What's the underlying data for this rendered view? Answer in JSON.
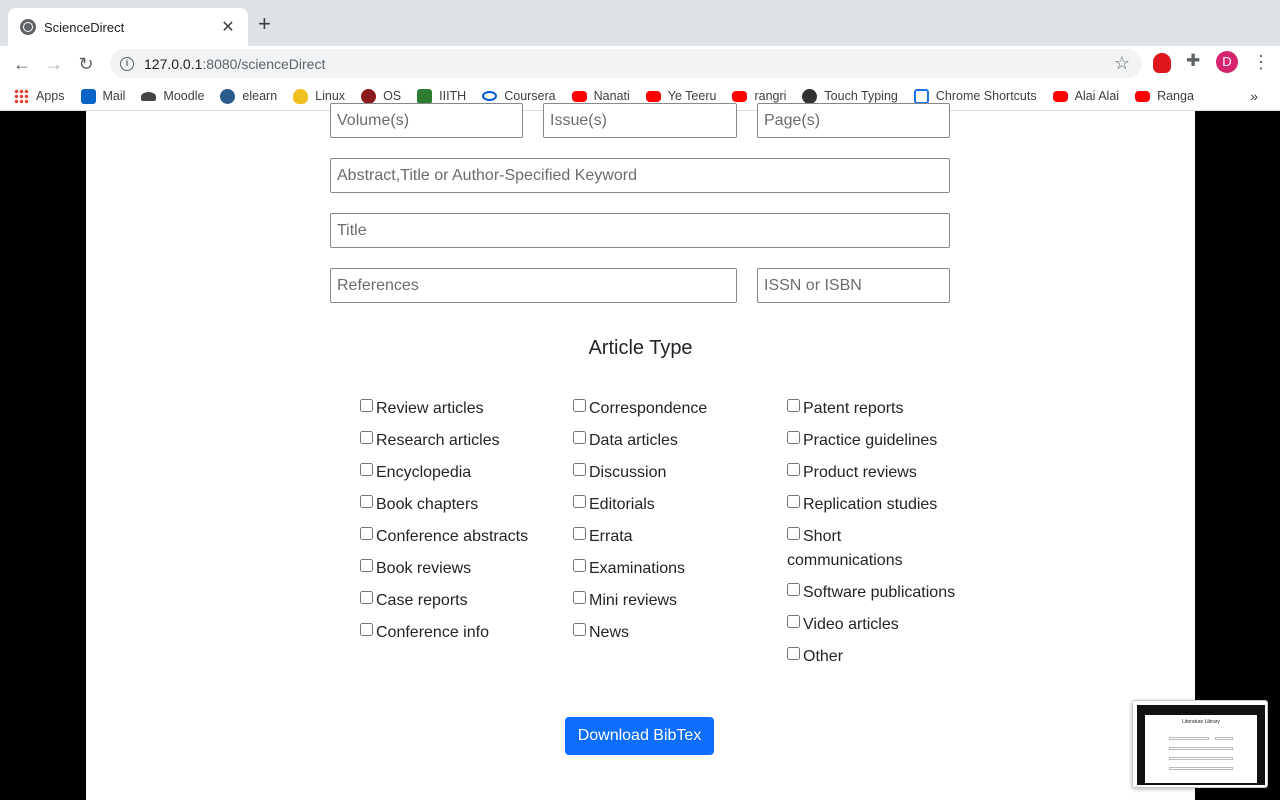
{
  "browser": {
    "tab_title": "ScienceDirect",
    "url_host": "127.0.0.1",
    "url_path": ":8080/scienceDirect",
    "avatar_letter": "D",
    "bookmarks": [
      {
        "label": "Apps",
        "icon": "apps-icon"
      },
      {
        "label": "Mail",
        "icon": "outlook-icon"
      },
      {
        "label": "Moodle",
        "icon": "moodle-icon"
      },
      {
        "label": "elearn",
        "icon": "elearn-icon"
      },
      {
        "label": "Linux",
        "icon": "linux-icon"
      },
      {
        "label": "OS",
        "icon": "os-icon"
      },
      {
        "label": "IIITH",
        "icon": "iiith-icon"
      },
      {
        "label": "Coursera",
        "icon": "coursera-icon"
      },
      {
        "label": "Nanati",
        "icon": "youtube-icon"
      },
      {
        "label": "Ye Teeru",
        "icon": "youtube-icon"
      },
      {
        "label": "rangri",
        "icon": "youtube-icon"
      },
      {
        "label": "Touch Typing",
        "icon": "touch-typing-icon"
      },
      {
        "label": "Chrome Shortcuts",
        "icon": "chrome-shortcuts-icon"
      },
      {
        "label": "Alai Alai",
        "icon": "youtube-icon"
      },
      {
        "label": "Ranga",
        "icon": "youtube-icon"
      }
    ],
    "bookmarks_overflow": "»"
  },
  "form": {
    "volume_placeholder": "Volume(s)",
    "issue_placeholder": "Issue(s)",
    "page_placeholder": "Page(s)",
    "keyword_placeholder": "Abstract,Title or Author-Specified Keyword",
    "title_placeholder": "Title",
    "references_placeholder": "References",
    "issn_placeholder": "ISSN or ISBN"
  },
  "article_type": {
    "heading": "Article Type",
    "col1": [
      "Review articles",
      "Research articles",
      "Encyclopedia",
      "Book chapters",
      "Conference abstracts",
      "Book reviews",
      "Case reports",
      "Conference info"
    ],
    "col2": [
      "Correspondence",
      "Data articles",
      "Discussion",
      "Editorials",
      "Errata",
      "Examinations",
      "Mini reviews",
      "News"
    ],
    "col3": [
      "Patent reports",
      "Practice guidelines",
      "Product reviews",
      "Replication studies",
      "Short communications",
      "Software publications",
      "Video articles",
      "Other"
    ]
  },
  "download_label": "Download BibTex",
  "thumbnail_title": "Literature Library"
}
